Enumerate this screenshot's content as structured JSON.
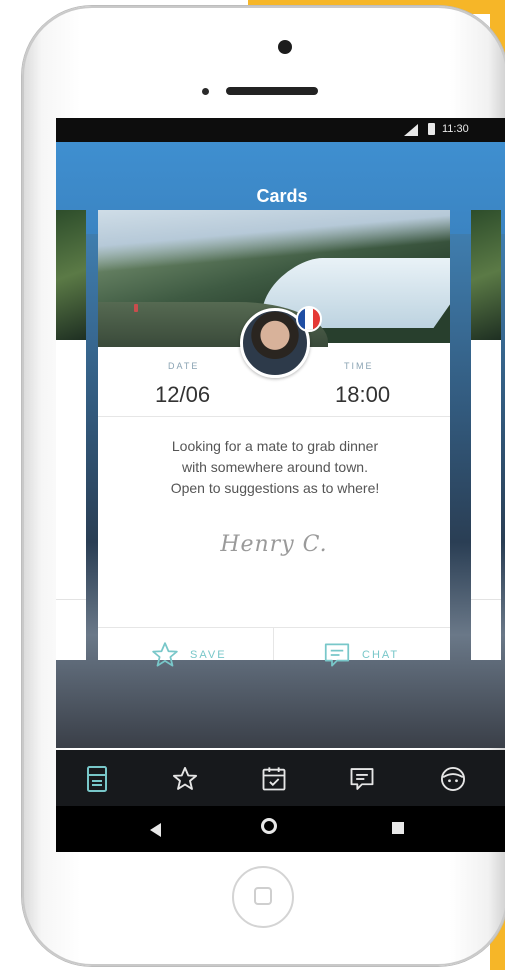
{
  "status_bar": {
    "time": "11:30"
  },
  "header": {
    "title": "Cards"
  },
  "card": {
    "date_label": "DATE",
    "date_value": "12/06",
    "time_label": "TIME",
    "time_value": "18:00",
    "message_lines": [
      "Looking for a mate to grab dinner",
      "with somewhere around town.",
      "Open to suggestions as to where!"
    ],
    "signature": "Henry C.",
    "flag_colors": [
      "#1f4ea3",
      "#ffffff",
      "#e53935"
    ],
    "actions": {
      "save_label": "SAVE",
      "chat_label": "CHAT"
    }
  },
  "tab_bar": {
    "icons": [
      "cards-icon",
      "star-icon",
      "calendar-check-icon",
      "chat-icon",
      "profile-face-icon"
    ],
    "active_color": "#78c7c9",
    "inactive_color": "#e6e6e6"
  },
  "colors": {
    "accent": "#3f8fd0",
    "action": "#78c7c9",
    "frame_yellow": "#f6b628"
  }
}
